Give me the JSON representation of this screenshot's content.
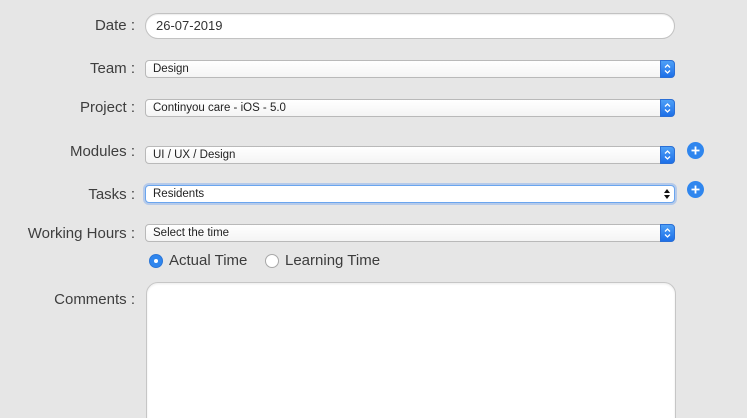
{
  "form": {
    "date": {
      "label": "Date :",
      "value": "26-07-2019"
    },
    "team": {
      "label": "Team :",
      "value": "Design"
    },
    "project": {
      "label": "Project :",
      "value": "Continyou care - iOS - 5.0"
    },
    "modules": {
      "label": "Modules :",
      "value": "UI / UX / Design"
    },
    "tasks": {
      "label": "Tasks :",
      "value": "Residents"
    },
    "working_hours": {
      "label": "Working Hours :",
      "value": "Select the time"
    },
    "time_type": {
      "options": [
        {
          "label": "Actual Time",
          "selected": true
        },
        {
          "label": "Learning Time",
          "selected": false
        }
      ]
    },
    "comments": {
      "label": "Comments :",
      "value": ""
    }
  },
  "colors": {
    "background": "#e6e6e6",
    "accent": "#2f86ee",
    "focus_ring": "#6aa5ee"
  },
  "icons": {
    "add": "plus-circle-icon",
    "select_stepper": "chevron-up-down-icon"
  }
}
